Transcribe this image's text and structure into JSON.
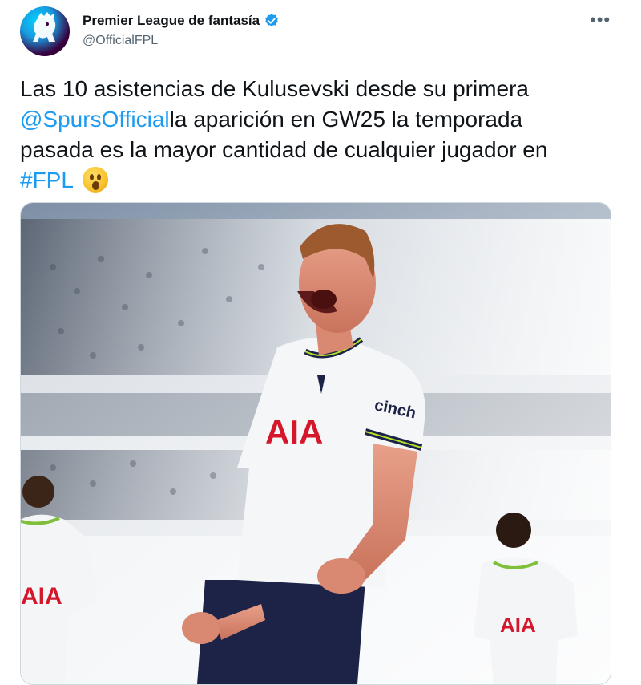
{
  "author": {
    "display_name": "Premier League de fantasía",
    "handle": "@OfficialFPL",
    "verified": true
  },
  "menu": {
    "more_label": "•••"
  },
  "tweet": {
    "line1": "Las 10 asistencias de Kulusevski desde su primera",
    "mention": "@SpursOfficial",
    "line2": "la aparición en GW25 la temporada",
    "line3": "pasada es la mayor cantidad de cualquier jugador en",
    "hashtag": "#FPL"
  },
  "media": {
    "shirt_sponsor": "AIA",
    "sleeve_sponsor": "cinch"
  },
  "colors": {
    "link": "#1d9bf0",
    "text": "#0f1419",
    "secondary": "#536471",
    "verified": "#1d9bf0"
  }
}
